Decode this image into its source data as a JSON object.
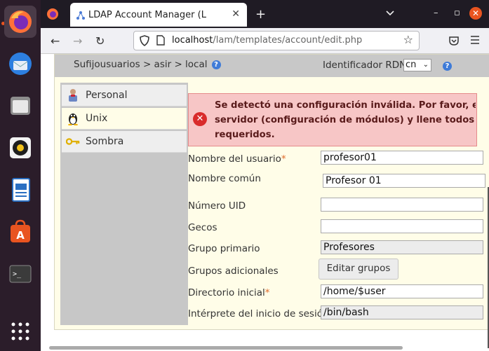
{
  "browser": {
    "tab_title": "LDAP Account Manager (L",
    "url_host": "localhost",
    "url_path": "/lam/templates/account/edit.php",
    "window_controls": {
      "minimize": "–",
      "maximize": "▫",
      "close": "✕"
    },
    "new_tab": "+",
    "tab_close": "✕"
  },
  "dock": {
    "items": [
      "firefox-icon",
      "thunderbird-icon",
      "files-icon",
      "rhythmbox-icon",
      "writer-icon",
      "software-icon",
      "terminal-icon",
      "apps-grid-icon"
    ]
  },
  "page": {
    "breadcrumb": "Sufijousuarios > asir > local",
    "rdn_label": "Identificador RDN",
    "rdn_value": "cn",
    "sidebar": [
      {
        "label": "Personal",
        "icon": "person-icon"
      },
      {
        "label": "Unix",
        "icon": "tux-icon"
      },
      {
        "label": "Sombra",
        "icon": "key-icon"
      }
    ],
    "error": {
      "line1": "Se detectó una configuración inválida. Por favor, edite s",
      "line2": "servidor (configuración de módulos) y llene todos los ca",
      "line3": "requeridos."
    },
    "form": {
      "username_label": "Nombre del usuario",
      "username_value": "profesor01",
      "cn_label": "Nombre común",
      "cn_value": "Profesor 01",
      "uid_label": "Número UID",
      "uid_value": "",
      "gecos_label": "Gecos",
      "gecos_value": "",
      "primary_group_label": "Grupo primario",
      "primary_group_value": "Profesores",
      "additional_groups_label": "Grupos adicionales",
      "edit_groups_button": "Editar grupos",
      "home_label": "Directorio inicial",
      "home_value": "/home/$user",
      "shell_label": "Intérprete del inicio de sesión",
      "shell_value": "/bin/bash"
    },
    "required_marker": "*"
  }
}
